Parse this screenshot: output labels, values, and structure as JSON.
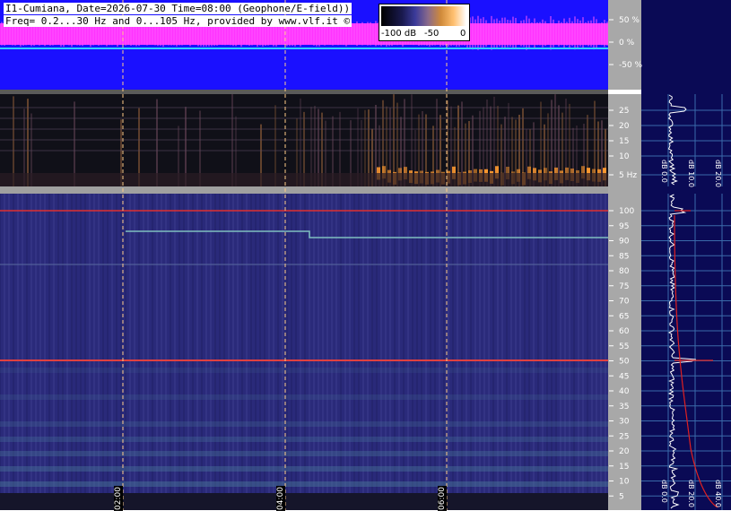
{
  "header": {
    "line1": "I1-Cumiana, Date=2026-07-30 Time=08:00 (Geophone/E-field))",
    "line2": "Freq= 0.2...30 Hz and 0...105 Hz, provided by www.vlf.it ©"
  },
  "colorbar": {
    "labels": [
      "-100 dB",
      "-50",
      "0"
    ]
  },
  "waveform": {
    "axis_labels": [
      "50 %",
      "0 %",
      "-50 %"
    ]
  },
  "spectrogram_low": {
    "axis_labels": [
      "25",
      "20",
      "15",
      "10",
      "5 Hz"
    ]
  },
  "spectrogram_high": {
    "axis_labels": [
      "100",
      "95",
      "90",
      "85",
      "80",
      "75",
      "70",
      "65",
      "60",
      "55",
      "50",
      "45",
      "40",
      "35",
      "30",
      "25",
      "20",
      "15",
      "10",
      "5"
    ]
  },
  "profile_low": {
    "axis_labels": [
      "dB 0.0",
      "dB 10.0",
      "dB 20.0"
    ]
  },
  "profile_high": {
    "axis_labels": [
      "dB 0.0",
      "dB 20.0",
      "dB 40.0"
    ]
  },
  "time_axis": {
    "labels": [
      "02:00",
      "04:00",
      "06:00"
    ]
  }
}
